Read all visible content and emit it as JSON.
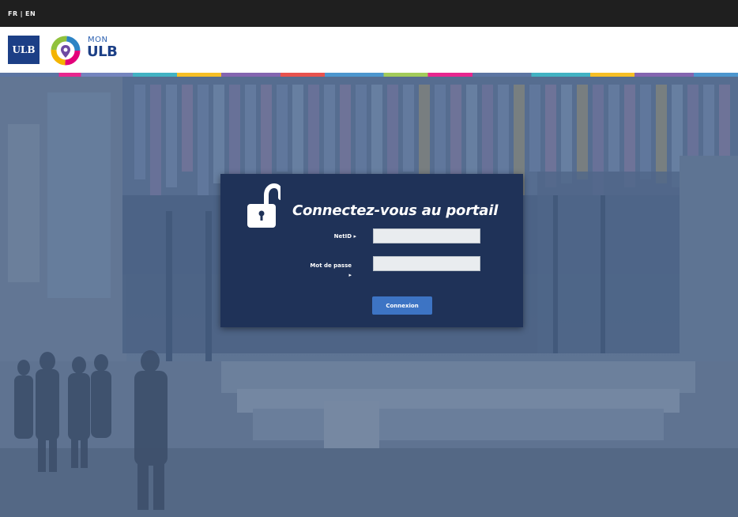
{
  "language_bar": {
    "fr_label": "FR",
    "separator": "|",
    "en_label": "EN"
  },
  "header": {
    "ulb_logo_text": "ULB",
    "monulb_top": "MON",
    "monulb_bottom": "ULB"
  },
  "login": {
    "title": "Connectez-vous au portail",
    "netid_label": "NetID",
    "netid_label_suffix": " ▸",
    "netid_value": "",
    "password_label": "Mot de passe",
    "password_label_suffix": "▸",
    "password_value": "",
    "submit_label": "Connexion"
  },
  "colors": {
    "top_bar": "#1f1f1f",
    "ulb_blue": "#1c3f86",
    "panel": "#1f3258",
    "button": "#3d74c4",
    "background_tint": "#647894"
  },
  "icons": {
    "lock": "unlocked-padlock-icon",
    "monulb_logo": "monulb-logo-icon"
  }
}
